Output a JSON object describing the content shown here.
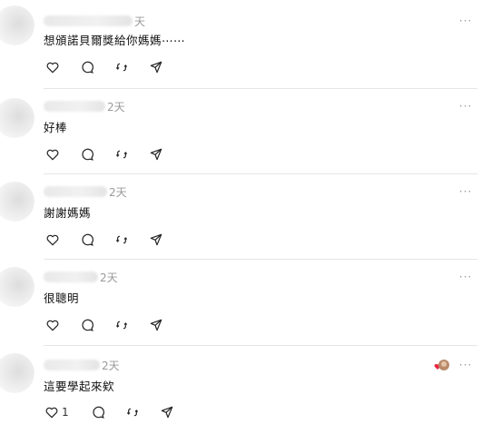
{
  "replies": [
    {
      "time": "天",
      "text": "想頒諾貝爾獎給你媽媽⋯⋯",
      "icons": [
        "heart-icon",
        "comment-icon",
        "repost-icon",
        "share-icon"
      ],
      "more_label": "···"
    },
    {
      "time": "2天",
      "text": "好棒",
      "more_label": "···"
    },
    {
      "time": "2天",
      "text": "謝謝媽媽",
      "more_label": "···"
    },
    {
      "time": "2天",
      "text": "很聰明",
      "more_label": "···"
    },
    {
      "time": "2天",
      "text": "這要學起來欸",
      "like_count": "1",
      "more_label": "···"
    }
  ],
  "colors": {
    "divider": "#e6e6e6",
    "muted_text": "#9a9a9a",
    "like_heart": "#e8253d"
  }
}
